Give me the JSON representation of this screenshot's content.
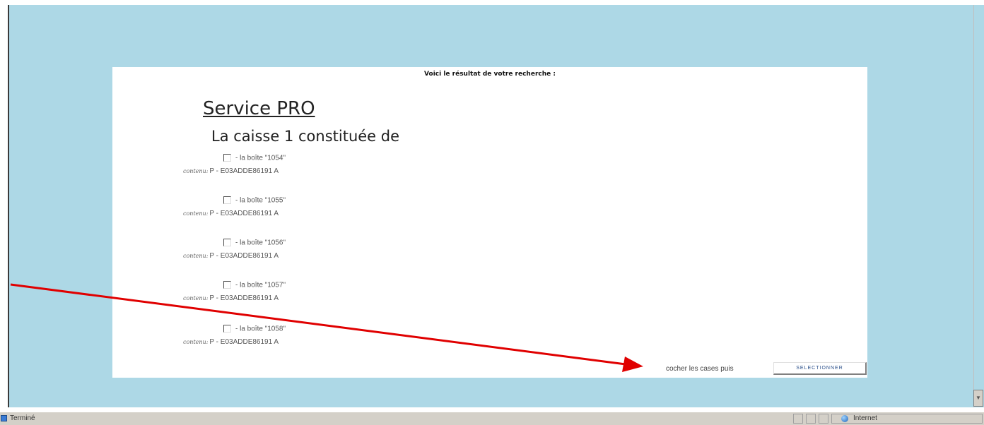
{
  "page": {
    "heading": "Voici le résultat de votre recherche :",
    "service_title": "Service PRO",
    "caisse_title": "La caisse 1 constituée de"
  },
  "items": [
    {
      "label": "- la boîte \"1054\"",
      "content_label": "contenu:",
      "content_value": "P - E03ADDE86191 A",
      "checked": false
    },
    {
      "label": "- la boîte \"1055\"",
      "content_label": "contenu:",
      "content_value": "P - E03ADDE86191 A",
      "checked": false
    },
    {
      "label": "- la boîte \"1056\"",
      "content_label": "contenu:",
      "content_value": "P - E03ADDE86191 A",
      "checked": false
    },
    {
      "label": "- la boîte \"1057\"",
      "content_label": "contenu:",
      "content_value": "P - E03ADDE86191 A",
      "checked": false
    },
    {
      "label": "- la boîte \"1058\"",
      "content_label": "contenu:",
      "content_value": "P - E03ADDE86191 A",
      "checked": false
    }
  ],
  "footer": {
    "instruction": "cocher les cases puis",
    "button_label": "SELECTIONNER"
  },
  "statusbar": {
    "status_text": "Terminé",
    "zone_text": "Internet"
  },
  "colors": {
    "background": "#add8e6",
    "panel": "#ffffff",
    "annotation_arrow": "#e00000"
  }
}
